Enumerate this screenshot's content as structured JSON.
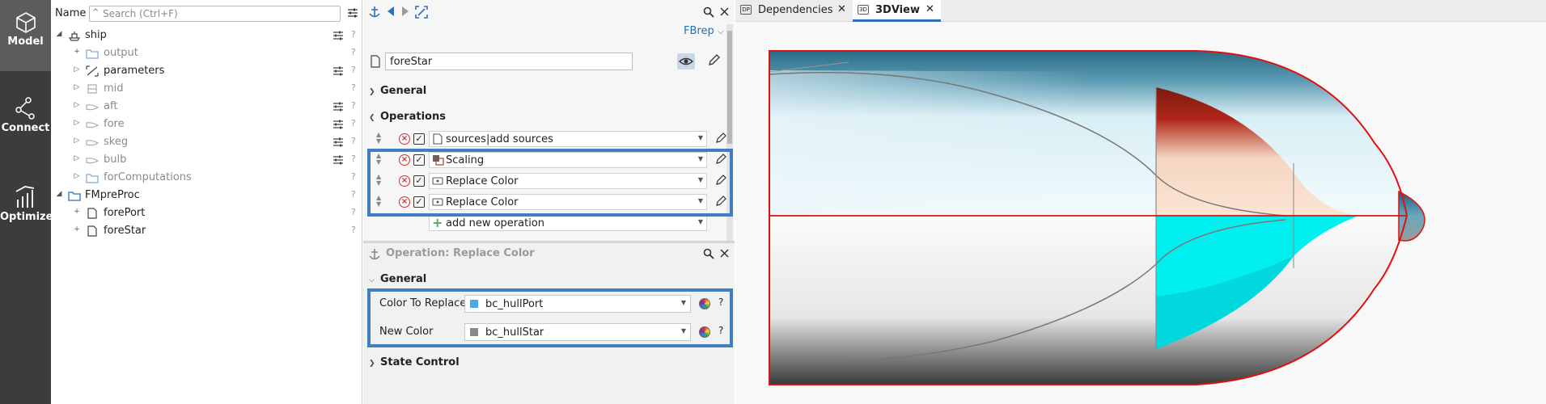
{
  "nav": {
    "items": [
      {
        "label": "Model",
        "icon": "cube-icon",
        "active": true
      },
      {
        "label": "Connect",
        "icon": "nodes-icon",
        "active": false
      },
      {
        "label": "Optimize",
        "icon": "bar-chart-icon",
        "active": false
      }
    ]
  },
  "tree": {
    "header_label": "Name",
    "search_placeholder": "Search (Ctrl+F)",
    "rows": [
      {
        "label": "ship",
        "expander": "◢",
        "icon": "ship-icon",
        "dim": false,
        "q": "?"
      },
      {
        "label": "output",
        "expander": "+",
        "icon": "folder-icon",
        "dim": true,
        "q": "?"
      },
      {
        "label": "parameters",
        "expander": "▷",
        "icon": "parameter-icon",
        "dim": false,
        "q": "?"
      },
      {
        "label": "mid",
        "expander": "▷",
        "icon": "mid-icon",
        "dim": true,
        "q": "?"
      },
      {
        "label": "aft",
        "expander": "▷",
        "icon": "hull-icon",
        "dim": false,
        "q": "?"
      },
      {
        "label": "fore",
        "expander": "▷",
        "icon": "hull-icon",
        "dim": false,
        "q": "?"
      },
      {
        "label": "skeg",
        "expander": "▷",
        "icon": "hull-icon",
        "dim": false,
        "q": "?"
      },
      {
        "label": "bulb",
        "expander": "▷",
        "icon": "hull-icon",
        "dim": false,
        "q": "?"
      },
      {
        "label": "forComputations",
        "expander": "▷",
        "icon": "folder-icon",
        "dim": false,
        "q": "?"
      },
      {
        "label": "FMpreProc",
        "expander": "◢",
        "icon": "folder-blue-icon",
        "dim": false,
        "q": "?"
      },
      {
        "label": "forePort",
        "expander": "+",
        "icon": "file-icon",
        "dim": false,
        "q": "?"
      },
      {
        "label": "foreStar",
        "expander": "+",
        "icon": "file-icon",
        "dim": false,
        "q": "?"
      }
    ]
  },
  "object": {
    "type_label": "FBrep",
    "name": "foreStar",
    "sections": {
      "general": "General",
      "operations": "Operations"
    },
    "operations": [
      {
        "label": "sources|add sources",
        "icon": "sources-icon"
      },
      {
        "label": "Scaling",
        "icon": "scaling-icon"
      },
      {
        "label": "Replace Color",
        "icon": "replace-color-icon"
      },
      {
        "label": "Replace Color",
        "icon": "replace-color-icon"
      }
    ],
    "add_operation": "add new operation"
  },
  "operation_panel": {
    "title": "Operation: Replace Color",
    "section_general": "General",
    "section_state": "State Control",
    "fields": [
      {
        "label": "Color To Replace",
        "value": "bc_hullPort",
        "swatch": "#4aa8e8"
      },
      {
        "label": "New Color",
        "value": "bc_hullStar",
        "swatch": "#8a8a8a"
      }
    ],
    "help": "?"
  },
  "tabs": [
    {
      "label": "Dependencies",
      "icon_text": "DP",
      "close": "✕",
      "active": false
    },
    {
      "label": "3DView",
      "icon_text": "3D",
      "close": "✕",
      "active": true
    }
  ],
  "colors": {
    "accent": "#2f6fba",
    "highlight_border": "#3f7fbf",
    "hull_blue": "#2a6b86",
    "hull_red": "#b0281a",
    "cyan": "#00f0f0",
    "outline_red": "#e01010"
  }
}
